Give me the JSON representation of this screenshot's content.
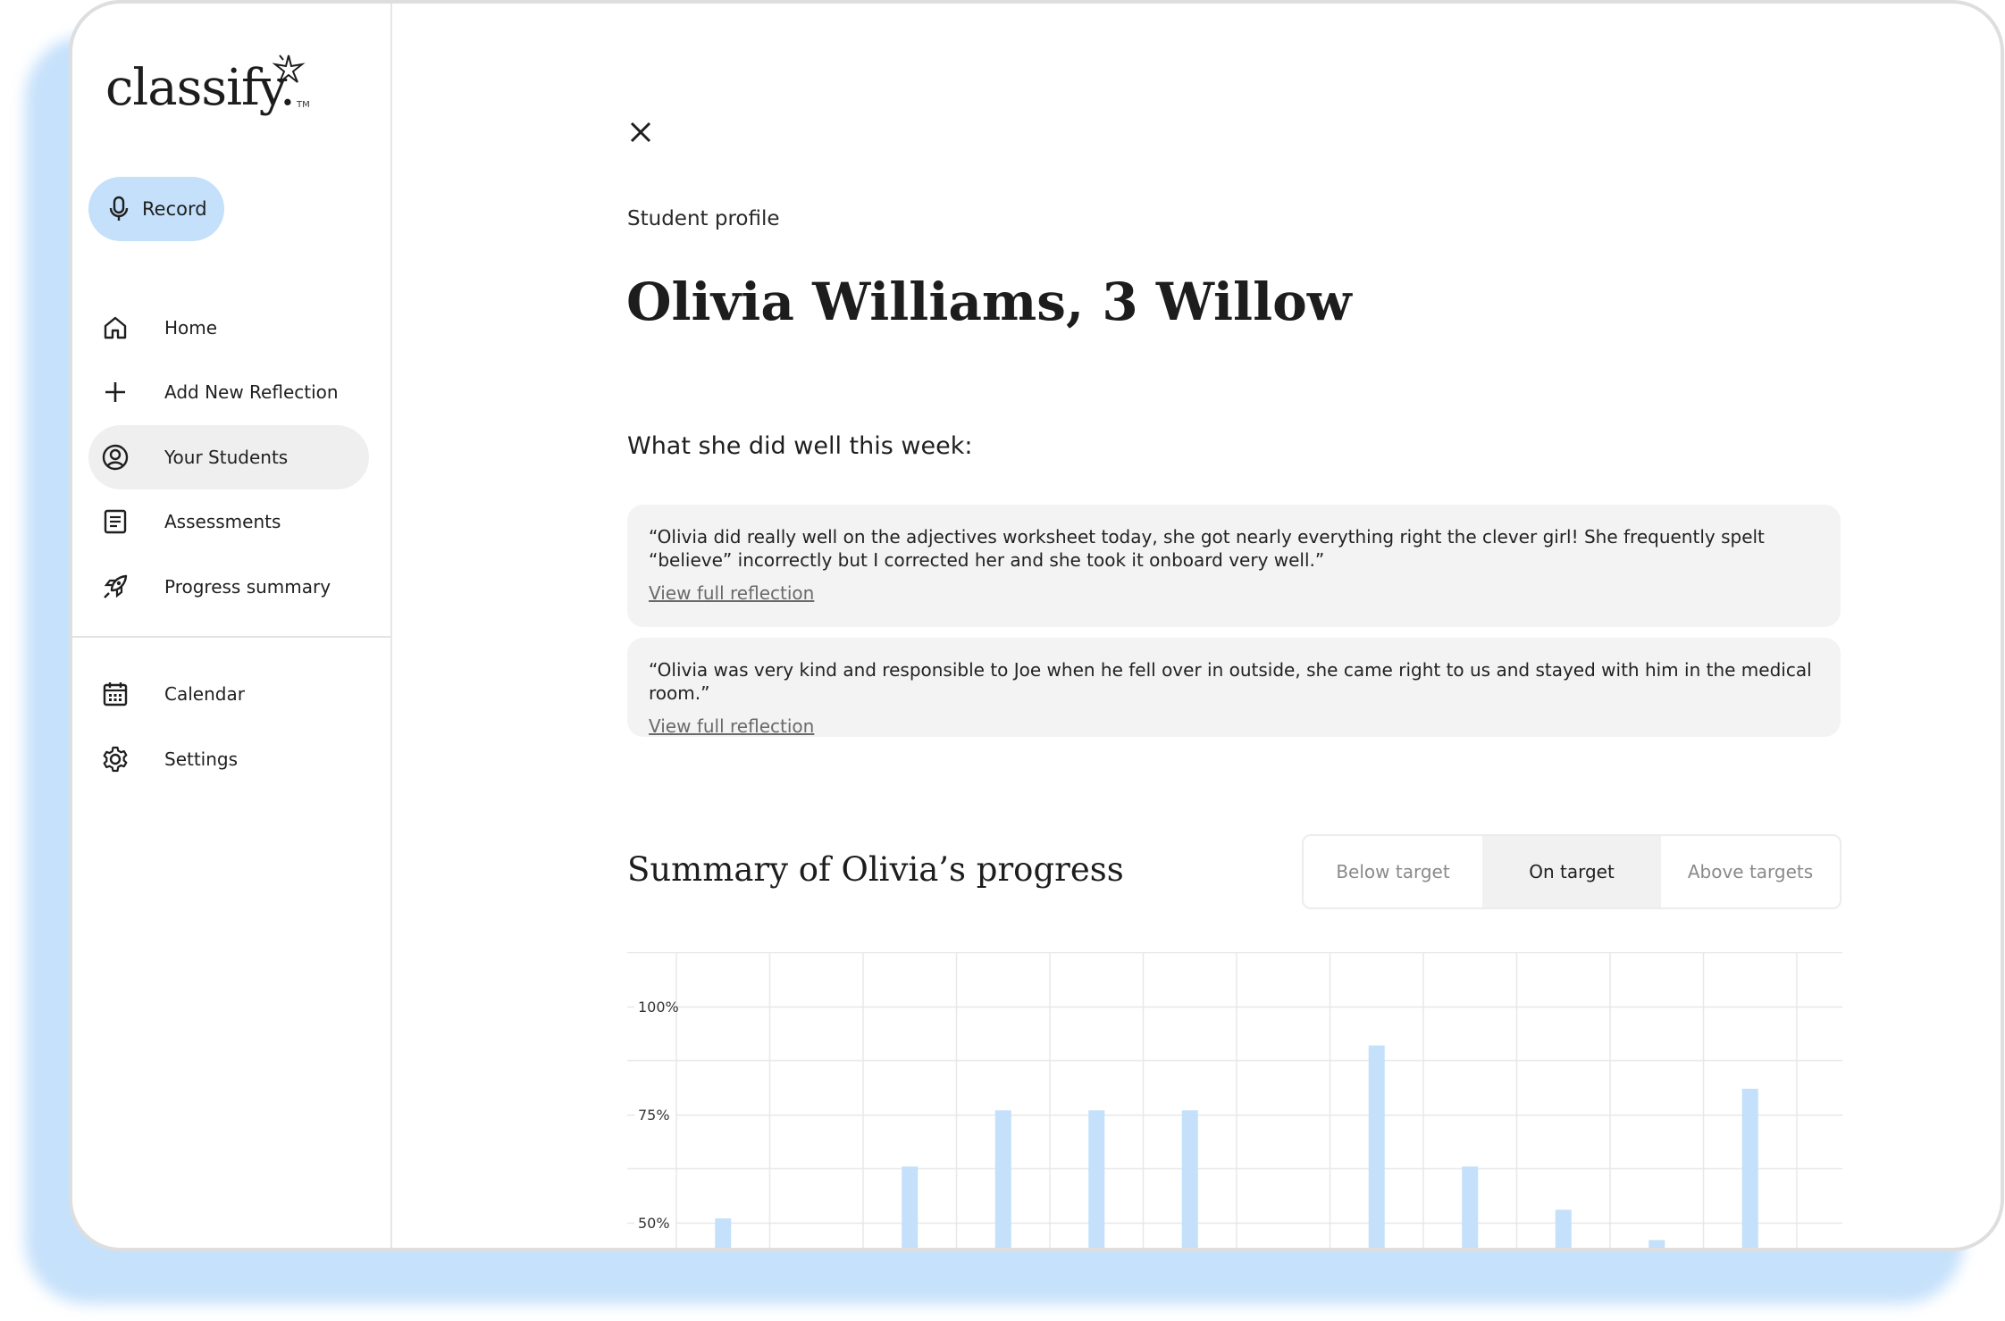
{
  "app": {
    "logo_text": "classify.",
    "logo_tm": "TM"
  },
  "sidebar": {
    "record_label": "Record",
    "items": [
      {
        "label": "Home",
        "icon": "home-icon"
      },
      {
        "label": "Add New Reflection",
        "icon": "plus-icon"
      },
      {
        "label": "Your Students",
        "icon": "user-circle-icon",
        "active": true
      },
      {
        "label": "Assessments",
        "icon": "document-icon"
      },
      {
        "label": "Progress summary",
        "icon": "rocket-icon"
      },
      {
        "label": "Calendar",
        "icon": "calendar-icon"
      },
      {
        "label": "Settings",
        "icon": "gear-icon"
      }
    ]
  },
  "profile": {
    "eyebrow": "Student profile",
    "name": "Olivia Williams, 3 Willow",
    "highlights_heading": "What she did well this week:",
    "reflections": [
      {
        "quote": "“Olivia did really well on the adjectives worksheet today, she got nearly everything right the clever girl! She frequently spelt “believe” incorrectly but I corrected her and she took it onboard very well.”",
        "link": "View full reflection"
      },
      {
        "quote": "“Olivia was very kind and responsible to Joe when he fell over in outside, she came right to us and stayed with him in the medical room.”",
        "link": "View full reflection"
      }
    ]
  },
  "summary": {
    "title": "Summary of Olivia’s progress",
    "filters": [
      "Below target",
      "On target",
      "Above targets"
    ],
    "selected_filter": "On target"
  },
  "colors": {
    "accent": "#c4e0fa",
    "bar": "#c4e0fa",
    "card": "#f3f3f3"
  },
  "chart_data": {
    "type": "bar",
    "yticks": [
      "100%",
      "75%",
      "50%"
    ],
    "ylim": [
      40,
      110
    ],
    "grid": true,
    "values": [
      51,
      null,
      63,
      76,
      76,
      76,
      null,
      91,
      63,
      53,
      46,
      81
    ]
  }
}
